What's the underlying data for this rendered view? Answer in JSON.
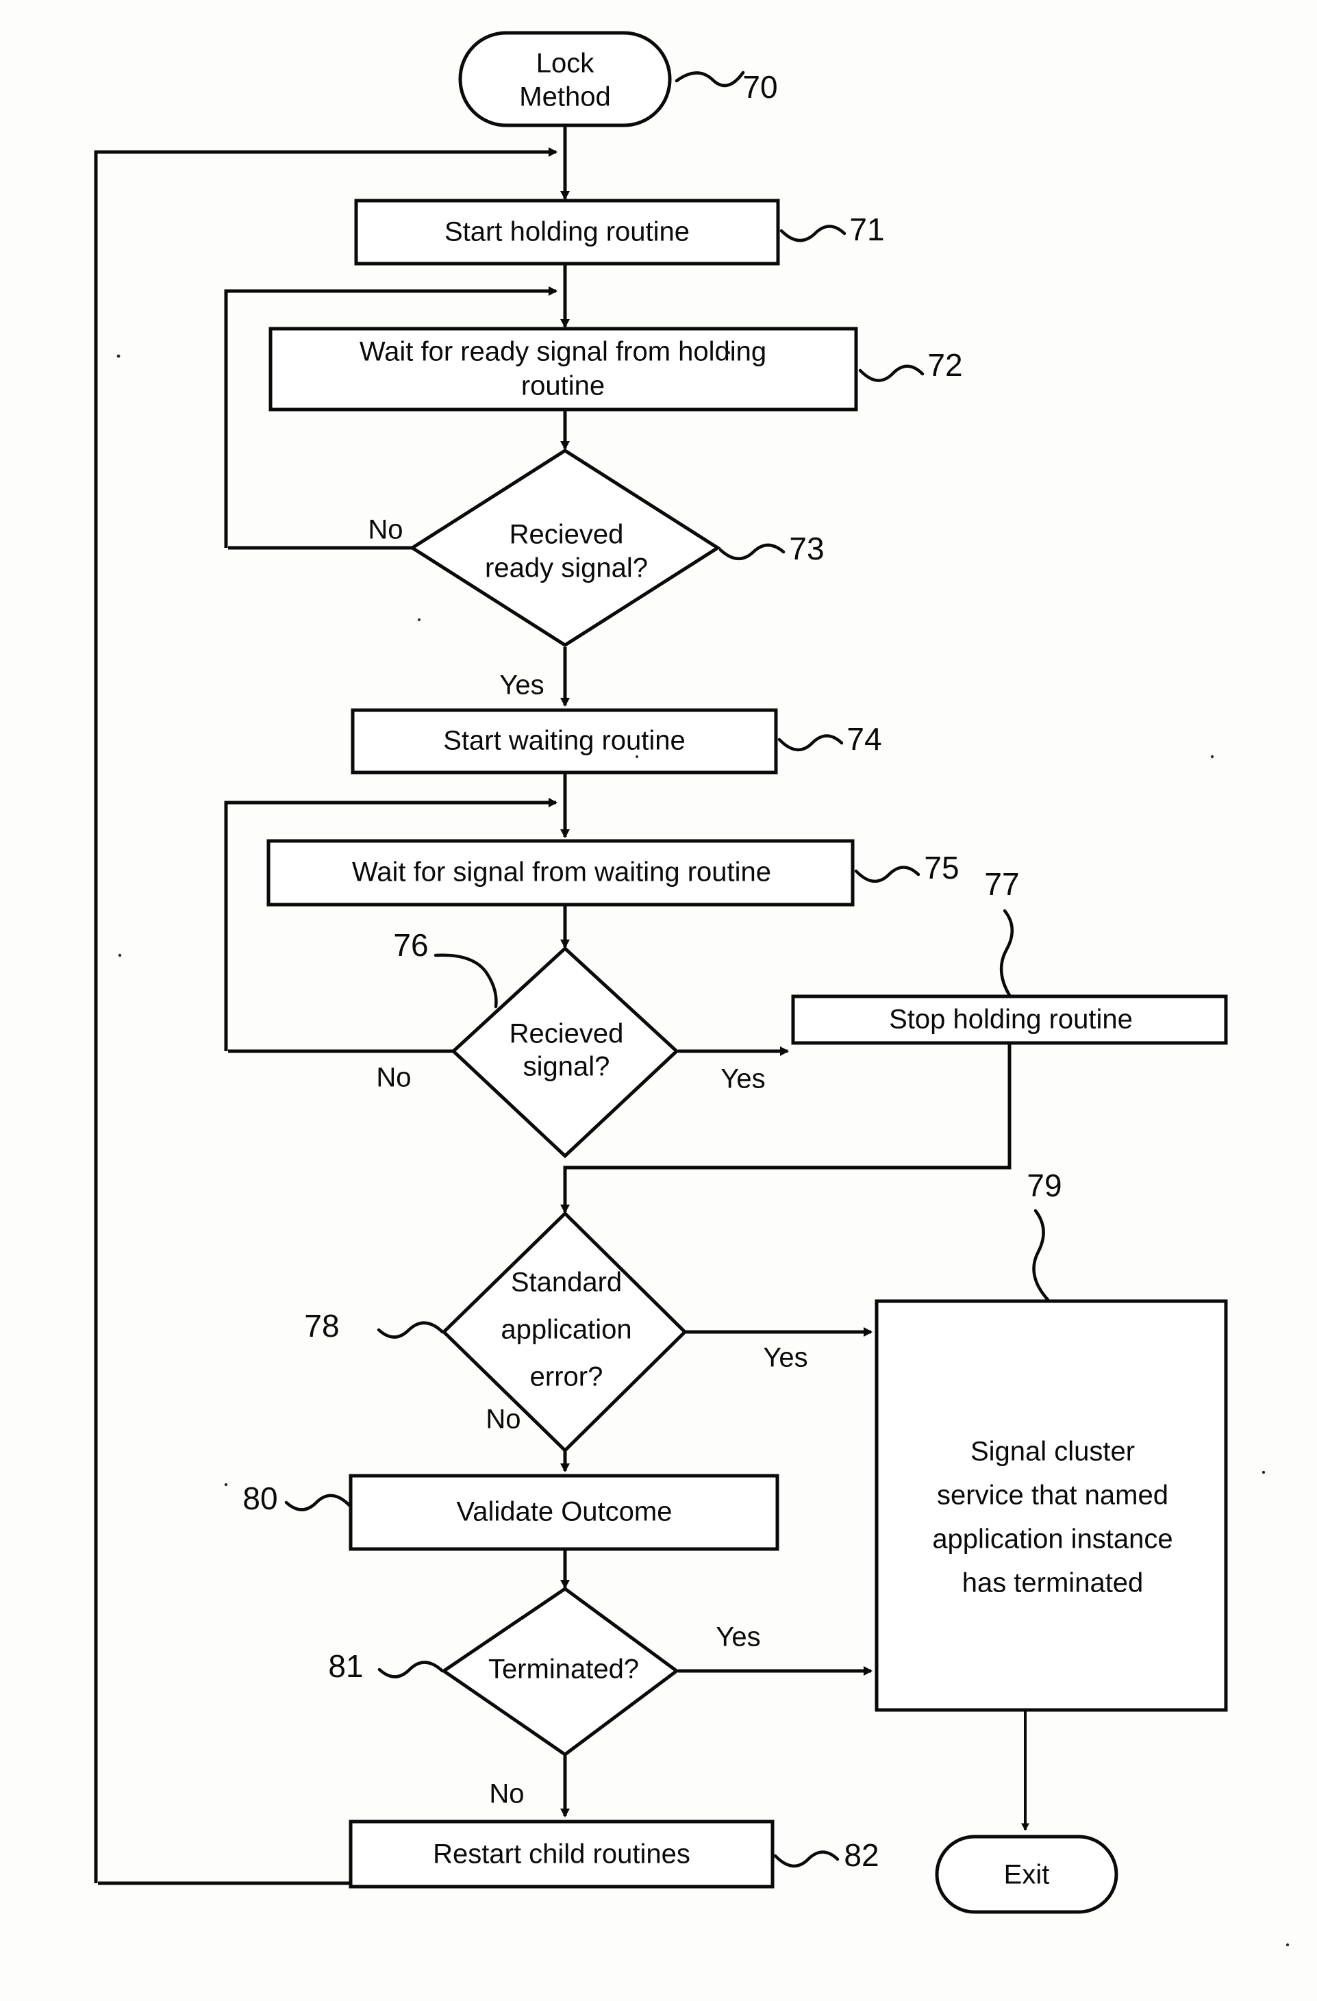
{
  "figure": {
    "kind": "patent-flowchart",
    "title": "Lock Method",
    "line_color": "#0a0a0a",
    "background_color": "#fdfdfb"
  },
  "nodes": {
    "start": {
      "ref": "70",
      "shape": "terminator",
      "line1": "Lock",
      "line2": "Method"
    },
    "n71": {
      "ref": "71",
      "shape": "process",
      "label": "Start holding routine"
    },
    "n72": {
      "ref": "72",
      "shape": "process",
      "line1": "Wait for ready signal from holding",
      "line2": "routine"
    },
    "n73": {
      "ref": "73",
      "shape": "decision",
      "line1": "Recieved",
      "line2": "ready signal?"
    },
    "n74": {
      "ref": "74",
      "shape": "process",
      "label": "Start waiting routine"
    },
    "n75": {
      "ref": "75",
      "shape": "process",
      "label": "Wait for signal from waiting routine"
    },
    "n76": {
      "ref": "76",
      "shape": "decision",
      "line1": "Recieved",
      "line2": "signal?"
    },
    "n77": {
      "ref": "77",
      "shape": "process",
      "label": "Stop holding routine"
    },
    "n78": {
      "ref": "78",
      "shape": "decision",
      "line1": "Standard",
      "line2": "application",
      "line3": "error?"
    },
    "n79": {
      "ref": "79",
      "shape": "process",
      "line1": "Signal cluster",
      "line2": "service that named",
      "line3": "application instance",
      "line4": "has terminated"
    },
    "n80": {
      "ref": "80",
      "shape": "process",
      "label": "Validate Outcome"
    },
    "n81": {
      "ref": "81",
      "shape": "decision",
      "label": "Terminated?"
    },
    "n82": {
      "ref": "82",
      "shape": "process",
      "label": "Restart child routines"
    },
    "exit": {
      "shape": "terminator",
      "label": "Exit"
    }
  },
  "edge_labels": {
    "e73_no": "No",
    "e73_yes": "Yes",
    "e76_no": "No",
    "e76_yes": "Yes",
    "e78_no": "No",
    "e78_yes": "Yes",
    "e81_no": "No",
    "e81_yes": "Yes"
  }
}
